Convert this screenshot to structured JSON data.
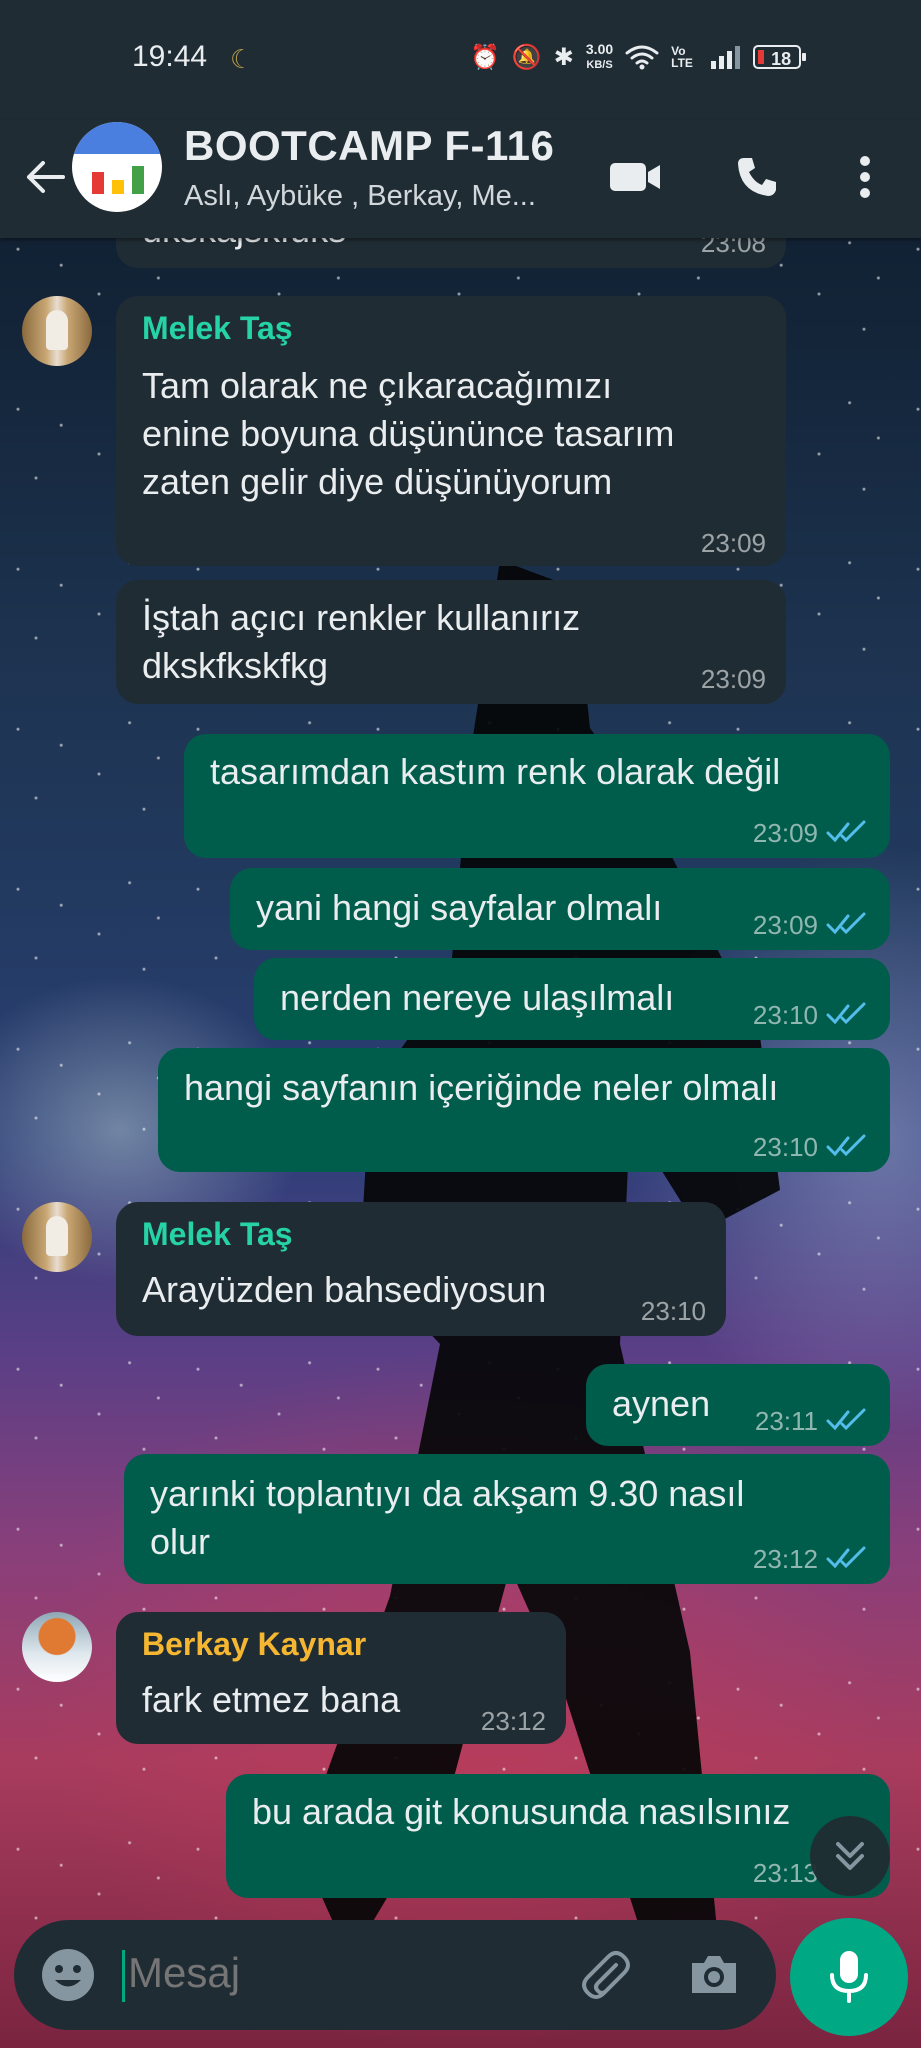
{
  "status_bar": {
    "time": "19:44",
    "net_speed_top": "3.00",
    "net_speed_bottom": "KB/S",
    "volte": "Vo LTE",
    "battery": "18"
  },
  "header": {
    "title": "BOOTCAMP F-116",
    "subtitle": "Aslı, Aybüke , Berkay, Me..."
  },
  "messages": [
    {
      "dir": "in",
      "text": "ukskajskfuks",
      "time": "23:08"
    },
    {
      "dir": "in",
      "sender": "Melek Taş",
      "text": "Tam olarak ne çıkaracağımızı\nenine boyuna düşününce tasarım\nzaten gelir diye düşünüyorum",
      "time": "23:09"
    },
    {
      "dir": "in",
      "text": "İştah açıcı renkler kullanırız\ndkskfkskfkg",
      "time": "23:09"
    },
    {
      "dir": "out",
      "text": "tasarımdan kastım renk olarak değil",
      "time": "23:09"
    },
    {
      "dir": "out",
      "text": "yani hangi sayfalar olmalı",
      "time": "23:09"
    },
    {
      "dir": "out",
      "text": "nerden nereye ulaşılmalı",
      "time": "23:10"
    },
    {
      "dir": "out",
      "text": "hangi sayfanın içeriğinde neler olmalı",
      "time": "23:10"
    },
    {
      "dir": "in",
      "sender": "Melek Taş",
      "text": "Arayüzden bahsediyosun",
      "time": "23:10"
    },
    {
      "dir": "out",
      "text": "aynen",
      "time": "23:11"
    },
    {
      "dir": "out",
      "text": "yarınki toplantıyı da akşam 9.30 nasıl\nolur",
      "time": "23:12"
    },
    {
      "dir": "in",
      "sender": "Berkay Kaynar",
      "text": "fark etmez bana",
      "time": "23:12"
    },
    {
      "dir": "out",
      "text": "bu arada git konusunda nasılsınız",
      "time": "23:13"
    }
  ],
  "input": {
    "placeholder": "Mesaj"
  },
  "colors": {
    "header_bg": "#1f2c34",
    "incoming_bubble": "#202c33",
    "outgoing_bubble": "#005c4b",
    "accent": "#00a884",
    "read_ticks": "#53bdeb",
    "sender_melek": "#25d3a6",
    "sender_berkay": "#f5b731"
  },
  "icons": [
    "back-arrow-icon",
    "video-call-icon",
    "phone-icon",
    "more-vert-icon",
    "emoji-icon",
    "attach-icon",
    "camera-icon",
    "mic-icon",
    "chevron-down-double-icon"
  ]
}
